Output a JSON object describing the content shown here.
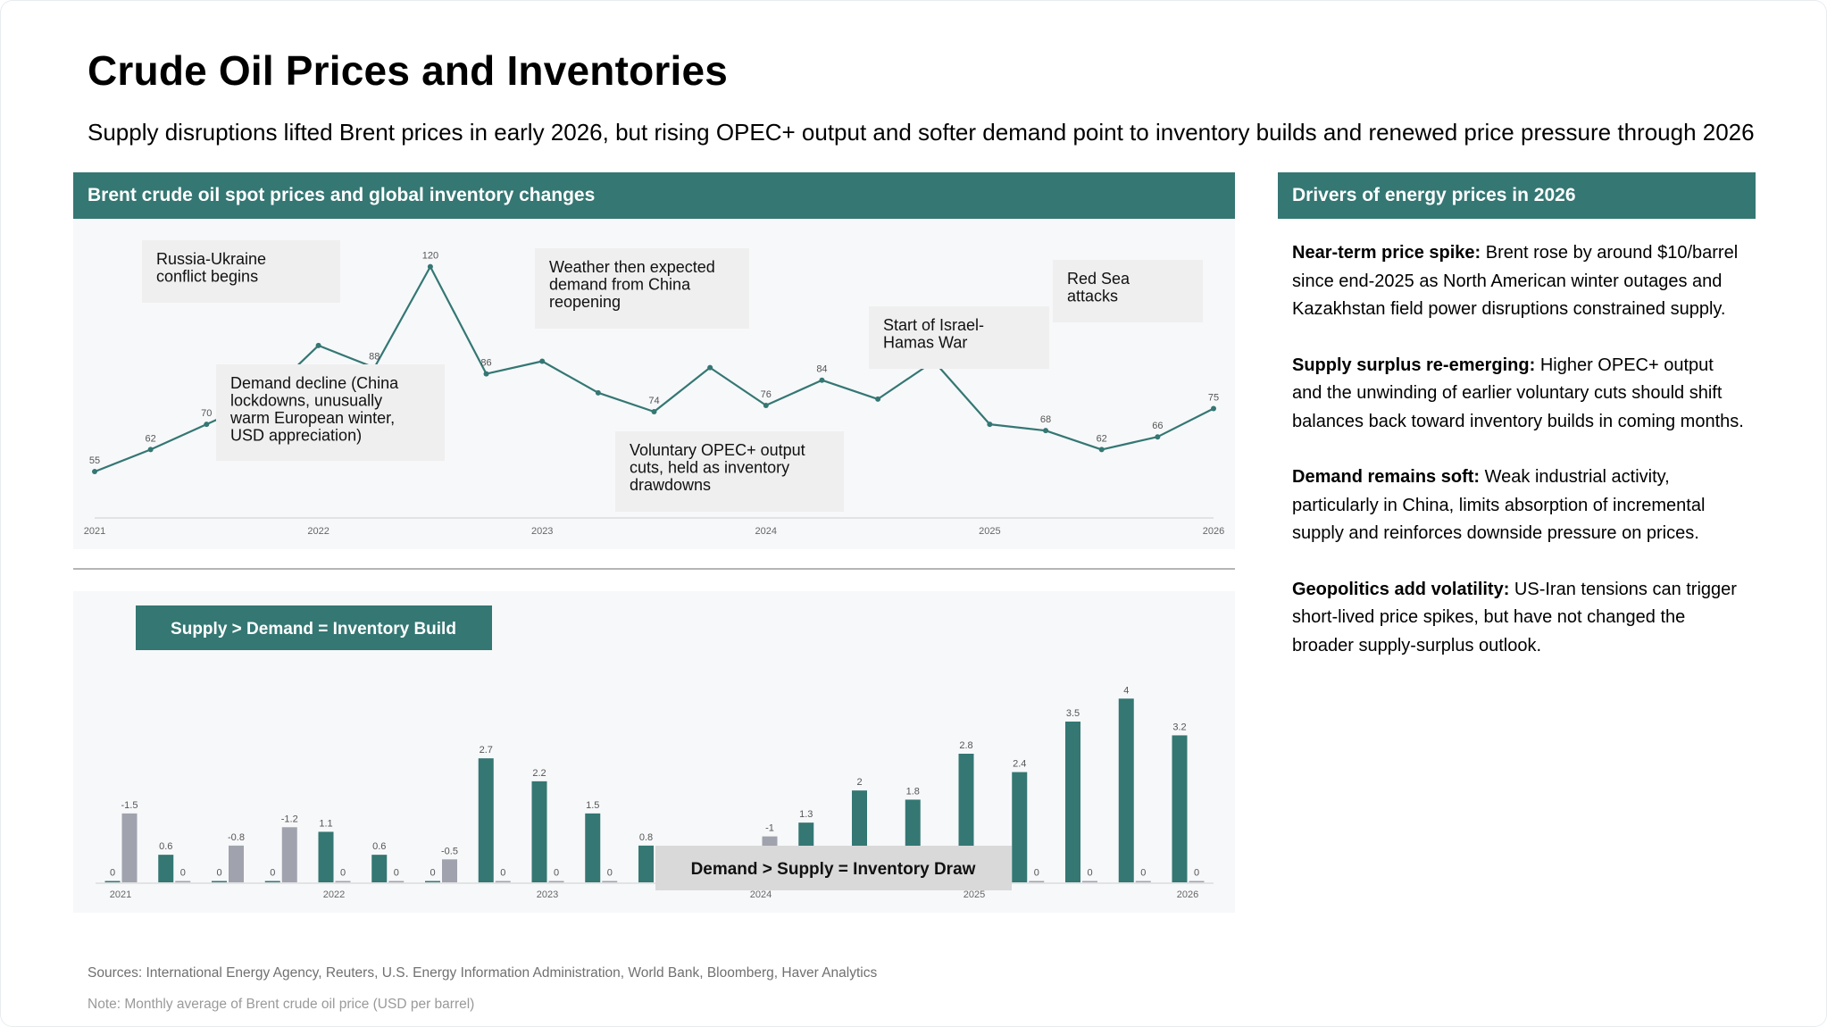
{
  "title": "Crude Oil Prices and Inventories",
  "subtitle": "Supply disruptions lifted Brent prices in early 2026, but rising OPEC+ output and softer demand point to inventory builds and renewed price pressure through 2026",
  "left_panel_title": "Brent crude oil spot prices and global inventory changes",
  "right_panel_title": "Drivers of energy prices in 2026",
  "colors": {
    "teal": "#347773",
    "gray_bar": "#a0a3ad",
    "annotation_bg": "#efefef"
  },
  "drivers": [
    {
      "heading": "Near-term price spike:",
      "text": " Brent rose by around $10/barrel since end-2025 as North American winter outages and Kazakhstan field power disruptions constrained supply."
    },
    {
      "heading": "Supply surplus re-emerging:",
      "text": " Higher OPEC+ output and the unwinding of earlier voluntary cuts should shift balances back toward inventory builds in coming months."
    },
    {
      "heading": "Demand remains soft:",
      "text": " Weak industrial activity, particularly in China, limits absorption of incremental supply and reinforces downside pressure on prices."
    },
    {
      "heading": "Geopolitics add volatility:",
      "text": " US-Iran tensions can trigger short-lived price spikes, but have not changed the broader supply-surplus outlook."
    }
  ],
  "footer": {
    "sources": "Sources: International Energy Agency, Reuters, U.S. Energy Information Administration, World Bank, Bloomberg, Haver Analytics",
    "note": "Note: Monthly average of Brent crude oil price (USD per barrel)"
  },
  "chart_data": [
    {
      "type": "line",
      "x_ticks": [
        "2021",
        "2022",
        "2023",
        "2024",
        "2025",
        "2026"
      ],
      "values": [
        55,
        62,
        70,
        78,
        95,
        88,
        120,
        86,
        90,
        80,
        74,
        88,
        76,
        84,
        78,
        90,
        70,
        68,
        62,
        66,
        75
      ],
      "labels": [
        "55",
        "62",
        "70",
        "78",
        "",
        "88",
        "120",
        "86",
        "",
        "",
        "74",
        "",
        "76",
        "84",
        "",
        "",
        "",
        "68",
        "62",
        "66",
        "75"
      ],
      "ylim": [
        40,
        125
      ],
      "annotations": [
        "Russia-Ukraine\nconflict begins",
        "Demand decline (China\nlockdowns, unusually\nwarm European winter,\nUSD appreciation)",
        "Weather then expected\ndemand from China\nreopening",
        "Voluntary OPEC+ output\ncuts, held as inventory\ndrawdowns",
        "Start of Israel-\nHamas War",
        "Red Sea\nattacks"
      ]
    },
    {
      "type": "bar",
      "x_ticks": [
        "2021",
        "2022",
        "2023",
        "2024",
        "2025",
        "2026"
      ],
      "series": [
        {
          "name": "Supply > Demand = Inventory Build",
          "values": [
            0,
            0.6,
            0,
            0,
            1.1,
            0.6,
            0,
            2.7,
            2.2,
            1.5,
            0.8,
            0,
            0,
            1.3,
            2,
            1.8,
            2.8,
            2.4,
            3.5,
            4,
            3.2
          ]
        },
        {
          "name": "Demand > Supply = Inventory Draw",
          "values": [
            1.5,
            0,
            0.8,
            1.2,
            0,
            0,
            0.5,
            0,
            0,
            0,
            0,
            0,
            1,
            0,
            0,
            0,
            0,
            0,
            0,
            0,
            0
          ]
        }
      ],
      "build_labels": [
        "0",
        "0.6",
        "0",
        "0",
        "1.1",
        "0.6",
        "0",
        "2.7",
        "2.2",
        "1.5",
        "0.8",
        "",
        "",
        "1.3",
        "2",
        "1.8",
        "2.8",
        "2.4",
        "3.5",
        "4",
        "3.2"
      ],
      "draw_labels": [
        "-1.5",
        "0",
        "-0.8",
        "-1.2",
        "0",
        "0",
        "-0.5",
        "0",
        "0",
        "0",
        "",
        "",
        "-1",
        "",
        "",
        "",
        "",
        "0",
        "0",
        "0",
        "0"
      ],
      "ylim": [
        0,
        4.2
      ]
    }
  ]
}
